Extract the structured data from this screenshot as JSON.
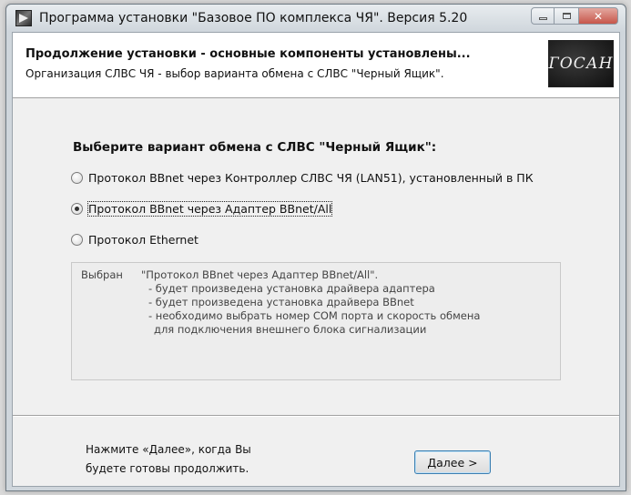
{
  "window": {
    "title": "Программа установки \"Базовое ПО комплекса ЧЯ\". Версия 5.20"
  },
  "header": {
    "title": "Продолжение установки - основные компоненты установлены...",
    "subtitle": "Организация СЛВС ЧЯ - выбор  варианта обмена с СЛВС \"Черный Ящик\".",
    "logo_text": "ГОСАН"
  },
  "main": {
    "question": "Выберите вариант обмена с СЛВС \"Черный Ящик\":",
    "options": [
      {
        "label": "Протокол BBnet через Контроллер СЛВС ЧЯ (LAN51), установленный в ПК",
        "selected": false
      },
      {
        "label": "Протокол BBnet через Адаптер BBnet/All",
        "selected": true
      },
      {
        "label": "Протокол Ethernet",
        "selected": false
      }
    ],
    "info": {
      "head": "Выбран",
      "lines": [
        "\"Протокол BBnet через Адаптер BBnet/All\".",
        "- будет произведена установка драйвера адаптера",
        "- будет произведена установка драйвера BBnet",
        "- необходимо выбрать номер COM порта  и скорость обмена",
        "для подключения внешнего блока сигнализации"
      ]
    }
  },
  "footer": {
    "hint_line1": "Нажмите «Далее», когда Вы",
    "hint_line2": "будете готовы продолжить.",
    "next_label": "Далее >"
  },
  "colors": {
    "close_button": "#c7564a",
    "focus_border": "#3c7fb1"
  },
  "icons": [
    "app-icon",
    "minimize-icon",
    "maximize-icon",
    "close-icon"
  ]
}
